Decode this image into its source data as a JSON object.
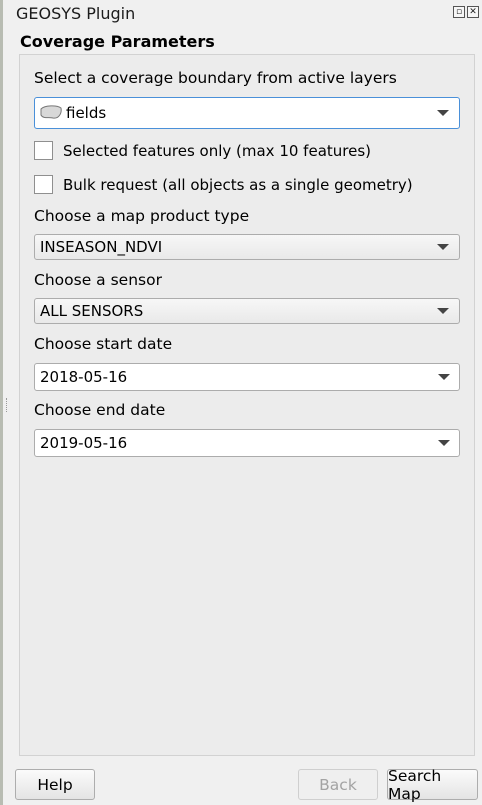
{
  "window": {
    "title": "GEOSYS Plugin"
  },
  "group": {
    "title": "Coverage Parameters"
  },
  "boundary": {
    "label": "Select a coverage boundary from active layers",
    "value": "fields",
    "icon": "polygon-layer-icon"
  },
  "options": {
    "selected_only": {
      "label": "Selected features only (max 10 features)",
      "checked": false
    },
    "bulk": {
      "label": "Bulk request (all objects as a single geometry)",
      "checked": false
    }
  },
  "product": {
    "label": "Choose a map product type",
    "value": "INSEASON_NDVI"
  },
  "sensor": {
    "label": "Choose a sensor",
    "value": "ALL SENSORS"
  },
  "start_date": {
    "label": "Choose start date",
    "value": "2018-05-16"
  },
  "end_date": {
    "label": "Choose end date",
    "value": "2019-05-16"
  },
  "buttons": {
    "help": "Help",
    "back": "Back",
    "search": "Search Map"
  },
  "colors": {
    "focus": "#4a90d9",
    "background": "#f0f0f0"
  }
}
